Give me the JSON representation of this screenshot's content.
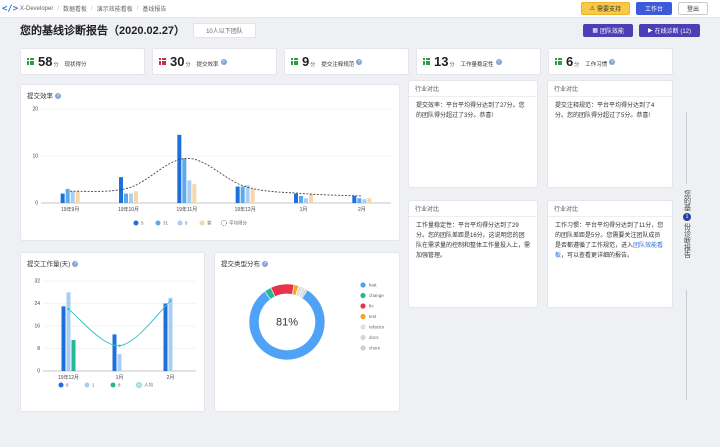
{
  "topbar": {
    "logo": "</>",
    "breadcrumbs": [
      "X-Developer",
      "数据看板",
      "演示效能看板",
      "基线报告"
    ],
    "buttons": {
      "support": "需要支持",
      "workbench": "工作台",
      "logout": "登出"
    }
  },
  "header": {
    "title": "您的基线诊断报告（2020.02.27）",
    "team_tab": "10人以下团队",
    "team_button": "团队效能",
    "online_button": "在线诊断 (12)"
  },
  "metrics": [
    {
      "value": "58",
      "unit": "分",
      "label": "现状得分",
      "color": "#2e9e44"
    },
    {
      "value": "30",
      "unit": "分",
      "label": "提交效率",
      "color": "#c2334d"
    },
    {
      "value": "9",
      "unit": "分",
      "label": "提交注释规范",
      "color": "#2e9e44"
    },
    {
      "value": "13",
      "unit": "分",
      "label": "工作量稳定性",
      "color": "#2e9e44"
    },
    {
      "value": "6",
      "unit": "分",
      "label": "工作习惯",
      "color": "#2e9e44"
    }
  ],
  "efficiency_chart": {
    "title": "提交效率",
    "chart_data": {
      "type": "bar",
      "categories": [
        "19年9月",
        "19年10月",
        "19年11月",
        "19年12月",
        "1月",
        "2月"
      ],
      "ylim": [
        0,
        20
      ],
      "yticks": [
        0,
        10,
        20
      ],
      "series": [
        {
          "name": "5",
          "color": "#1e6fd9",
          "values": [
            2,
            5.5,
            14.5,
            3.5,
            2,
            1.5
          ]
        },
        {
          "name": "31",
          "color": "#5aa9f0",
          "values": [
            3,
            2,
            9.5,
            3.5,
            1.5,
            1
          ]
        },
        {
          "name": "8",
          "color": "#a9cdf5",
          "values": [
            2.5,
            2,
            4.8,
            3.8,
            1,
            0.8
          ]
        },
        {
          "name": "普",
          "color": "#f5d7a8",
          "values": [
            2.5,
            2.5,
            4,
            3,
            2,
            1
          ]
        }
      ],
      "avg_line_name": "平均得分",
      "avg_line": [
        2.5,
        3.2,
        9.5,
        3.5,
        2,
        1.5
      ]
    }
  },
  "industry_cards": [
    {
      "head": "行业对比",
      "text": "提交效率：平台平均得分达到了27分。您的团队得分超过了3分。恭喜!"
    },
    {
      "head": "行业对比",
      "text": "提交注释规范：平台平均得分达到了4分。您的团队得分超过了5分。恭喜!"
    },
    {
      "head": "行业对比",
      "text": "工作量稳定性：平台平均得分达到了29分。您的团队差距是16分。这说明您的团队在需求量的控制和整体工作量投入上，需加强管理。"
    },
    {
      "head": "行业对比",
      "text_pre": "工作习惯：平台平均得分达到了11分，您的团队差距是5分。您需要关注团队成员是否都遵循了工作规范，进入",
      "link": "团队效能看板",
      "text_post": "，可以查看更详细的报告。"
    }
  ],
  "workload_chart": {
    "title": "提交工作量(天)",
    "chart_data": {
      "type": "bar",
      "categories": [
        "19年12月",
        "1月",
        "2月"
      ],
      "ylim": [
        0,
        32
      ],
      "yticks": [
        0,
        8,
        16,
        24,
        32
      ],
      "series": [
        {
          "name": "8",
          "color": "#1e6fd9",
          "values": [
            23,
            13,
            24
          ]
        },
        {
          "name": "1",
          "color": "#a9cdf5",
          "values": [
            28,
            6,
            26
          ]
        },
        {
          "name": "8",
          "color": "#26b79a",
          "values": [
            11,
            0,
            0
          ]
        }
      ],
      "avg_line_name": "人均",
      "avg_line": [
        22,
        9,
        25
      ]
    }
  },
  "type_chart": {
    "title": "提交类型分布",
    "center_label": "81%",
    "chart_data": {
      "type": "pie",
      "labels": [
        "feat",
        "change",
        "fix",
        "test",
        "refactor",
        "docs",
        "chore"
      ],
      "values": [
        81,
        3,
        10,
        2,
        2,
        1,
        1
      ],
      "colors": [
        "#4fa3f7",
        "#26b79a",
        "#e8334a",
        "#f5a623",
        "#e0e0e0",
        "#d6d6d6",
        "#cfcfcf"
      ]
    }
  },
  "side_tab": {
    "text_top": "您的基",
    "num": "1",
    "text_bottom": "份诊断报告"
  }
}
